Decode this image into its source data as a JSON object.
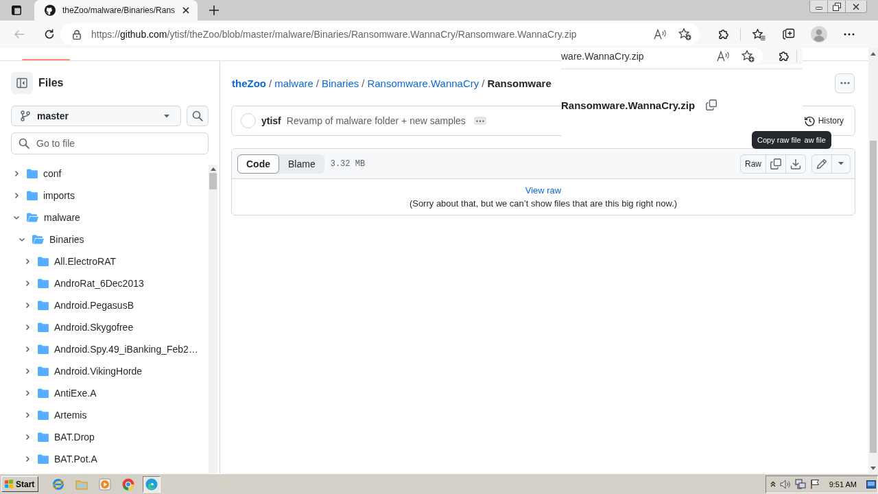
{
  "browser": {
    "tab_title": "theZoo/malware/Binaries/Rans",
    "back": {
      "disabled": true
    },
    "url": {
      "scheme": "https://",
      "host": "github.com",
      "path": "/ytisf/theZoo/blob/master/malware/Binaries/Ransomware.WannaCry/Ransomware.WannaCry.zip"
    }
  },
  "overlay": {
    "address_fragment": "ware.WannaCry.zip",
    "heading": "Ransomware.WannaCry.zip"
  },
  "sidebar": {
    "title": "Files",
    "branch": "master",
    "search": {
      "placeholder": "Go to file"
    },
    "tree": [
      {
        "label": "conf",
        "expanded": false
      },
      {
        "label": "imports",
        "expanded": false
      },
      {
        "label": "malware",
        "expanded": true,
        "children": [
          {
            "label": "Binaries",
            "expanded": true,
            "children": [
              {
                "label": "All.ElectroRAT",
                "expanded": false
              },
              {
                "label": "AndroRat_6Dec2013",
                "expanded": false
              },
              {
                "label": "Android.PegasusB",
                "expanded": false
              },
              {
                "label": "Android.Skygofree",
                "expanded": false
              },
              {
                "label": "Android.Spy.49_iBanking_Feb2…",
                "expanded": false
              },
              {
                "label": "Android.VikingHorde",
                "expanded": false
              },
              {
                "label": "AntiExe.A",
                "expanded": false
              },
              {
                "label": "Artemis",
                "expanded": false
              },
              {
                "label": "BAT.Drop",
                "expanded": false
              },
              {
                "label": "BAT.Pot.A",
                "expanded": false
              }
            ]
          }
        ]
      }
    ]
  },
  "breadcrumb": [
    {
      "kind": "repo",
      "label": "theZoo"
    },
    {
      "kind": "separator",
      "label": "/"
    },
    {
      "kind": "dir",
      "label": "malware"
    },
    {
      "kind": "separator",
      "label": "/"
    },
    {
      "kind": "dir",
      "label": "Binaries"
    },
    {
      "kind": "separator",
      "label": "/"
    },
    {
      "kind": "dir",
      "label": "Ransomware.WannaCry"
    },
    {
      "kind": "separator",
      "label": "/"
    },
    {
      "kind": "current",
      "label": "Ransomware"
    }
  ],
  "commit": {
    "author": "ytisf",
    "message": "Revamp of malware folder + new samples",
    "history": "History"
  },
  "file": {
    "views": [
      {
        "label": "Code",
        "selected": true
      },
      {
        "label": "Blame",
        "selected": false
      }
    ],
    "size": "3.32 MB",
    "raw": "Raw",
    "tooltip": [
      "Copy raw file",
      "aw file"
    ],
    "view_raw": "View raw",
    "notice": "(Sorry about that, but we can’t show files that are this big right now.)"
  },
  "taskbar": {
    "start": "Start",
    "apps": [
      {
        "kind": "ie",
        "selected": false
      },
      {
        "kind": "explorer",
        "selected": false
      },
      {
        "kind": "media",
        "selected": false
      },
      {
        "kind": "chrome",
        "selected": false
      },
      {
        "kind": "edge",
        "selected": true
      }
    ],
    "clock": "9:51 AM"
  }
}
